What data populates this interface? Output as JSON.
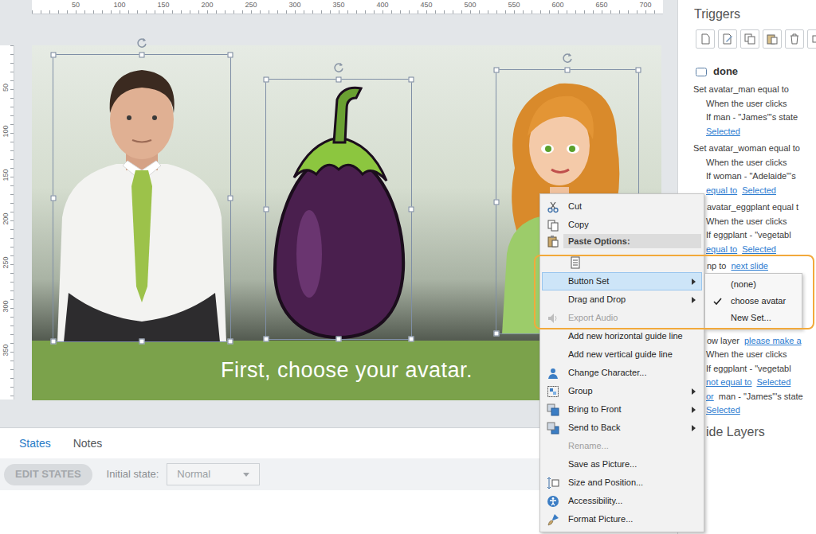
{
  "ruler": {
    "horizontal": [
      "50",
      "100",
      "150",
      "200",
      "250",
      "300",
      "350",
      "400",
      "450",
      "500",
      "550",
      "600",
      "650",
      "700"
    ],
    "vertical": [
      "50",
      "100",
      "150",
      "200",
      "250",
      "300",
      "350"
    ]
  },
  "slide": {
    "caption": "First, choose your avatar.",
    "objects": [
      {
        "kind": "man",
        "selected": true
      },
      {
        "kind": "eggplant",
        "selected": true
      },
      {
        "kind": "woman",
        "selected": true
      }
    ]
  },
  "states_panel": {
    "tabs": [
      {
        "label": "States",
        "selected": true
      },
      {
        "label": "Notes",
        "selected": false
      }
    ],
    "edit_button": {
      "label": "EDIT STATES",
      "disabled": true
    },
    "initial_state": {
      "label": "Initial state:",
      "value": "Normal",
      "disabled": true
    }
  },
  "context_menu": {
    "items": [
      {
        "kind": "item",
        "label": "Cut",
        "disabled": false,
        "submenu": false,
        "highlighted": false
      },
      {
        "kind": "item",
        "label": "Copy",
        "disabled": false,
        "submenu": false,
        "highlighted": false
      },
      {
        "kind": "header",
        "label": "Paste Options:"
      },
      {
        "kind": "paste-row"
      },
      {
        "kind": "item",
        "label": "Button Set",
        "disabled": false,
        "submenu": true,
        "highlighted": true
      },
      {
        "kind": "item",
        "label": "Drag and Drop",
        "disabled": false,
        "submenu": true,
        "highlighted": false
      },
      {
        "kind": "item",
        "label": "Export Audio",
        "disabled": true,
        "submenu": false,
        "highlighted": false
      },
      {
        "kind": "item",
        "label": "Add new horizontal guide line",
        "disabled": false,
        "submenu": false,
        "highlighted": false
      },
      {
        "kind": "item",
        "label": "Add new vertical guide line",
        "disabled": false,
        "submenu": false,
        "highlighted": false
      },
      {
        "kind": "item",
        "label": "Change Character...",
        "disabled": false,
        "submenu": false,
        "highlighted": false
      },
      {
        "kind": "item",
        "label": "Group",
        "disabled": false,
        "submenu": true,
        "highlighted": false
      },
      {
        "kind": "item",
        "label": "Bring to Front",
        "disabled": false,
        "submenu": true,
        "highlighted": false
      },
      {
        "kind": "item",
        "label": "Send to Back",
        "disabled": false,
        "submenu": true,
        "highlighted": false
      },
      {
        "kind": "item",
        "label": "Rename...",
        "disabled": true,
        "submenu": false,
        "highlighted": false
      },
      {
        "kind": "item",
        "label": "Save as Picture...",
        "disabled": false,
        "submenu": false,
        "highlighted": false
      },
      {
        "kind": "item",
        "label": "Size and Position...",
        "disabled": false,
        "submenu": false,
        "highlighted": false
      },
      {
        "kind": "item",
        "label": "Accessibility...",
        "disabled": false,
        "submenu": false,
        "highlighted": false
      },
      {
        "kind": "item",
        "label": "Format Picture...",
        "disabled": false,
        "submenu": false,
        "highlighted": false
      }
    ]
  },
  "submenu": {
    "items": [
      {
        "label": "(none)",
        "checked": false
      },
      {
        "label": "choose avatar",
        "checked": true
      },
      {
        "label": "New Set...",
        "checked": false
      }
    ]
  },
  "triggers_panel": {
    "title": "Triggers",
    "trigger_name": "done",
    "groups": [
      [
        {
          "lines": [
            {
              "kind": "action",
              "parts": [
                {
                  "text": "Set avatar_man equal to",
                  "link": false
                }
              ]
            },
            {
              "kind": "detail",
              "parts": [
                {
                  "text": "When the user clicks",
                  "link": false
                }
              ]
            },
            {
              "kind": "detail",
              "parts": [
                {
                  "text": "If man - \"James\"'s state",
                  "link": false
                }
              ]
            },
            {
              "kind": "detail",
              "parts": [
                {
                  "text": "Selected",
                  "link": true
                }
              ]
            }
          ]
        },
        {
          "lines": [
            {
              "kind": "action",
              "parts": [
                {
                  "text": "Set avatar_woman equal to",
                  "link": false
                }
              ]
            },
            {
              "kind": "detail",
              "parts": [
                {
                  "text": "When the user clicks",
                  "link": false
                }
              ]
            },
            {
              "kind": "detail",
              "parts": [
                {
                  "text": "If woman - \"Adelaide\"'s",
                  "link": false
                }
              ]
            },
            {
              "kind": "detail",
              "parts": [
                {
                  "text": "equal to",
                  "link": true
                },
                {
                  "text": "Selected",
                  "link": true
                }
              ]
            }
          ]
        },
        {
          "lines": [
            {
              "kind": "action-partial",
              "parts": [
                {
                  "text": "avatar_eggplant equal t",
                  "link": false
                }
              ]
            },
            {
              "kind": "detail",
              "parts": [
                {
                  "text": "When the user clicks",
                  "link": false
                }
              ]
            },
            {
              "kind": "detail",
              "parts": [
                {
                  "text": "If eggplant - \"vegetabl",
                  "link": false
                }
              ]
            },
            {
              "kind": "detail",
              "parts": [
                {
                  "text": "equal to",
                  "link": true
                },
                {
                  "text": "Selected",
                  "link": true
                }
              ]
            }
          ]
        },
        {
          "lines": [
            {
              "kind": "action-partial",
              "parts": [
                {
                  "text": "np to",
                  "link": false
                },
                {
                  "text": "next slide",
                  "link": true
                }
              ]
            }
          ]
        }
      ],
      [
        {
          "lines": [
            {
              "kind": "action-partial",
              "parts": [
                {
                  "text": "ow layer",
                  "link": false
                },
                {
                  "text": "please make a",
                  "link": true
                }
              ]
            },
            {
              "kind": "detail",
              "parts": [
                {
                  "text": "When the user clicks",
                  "link": false
                }
              ]
            },
            {
              "kind": "detail",
              "parts": [
                {
                  "text": "If eggplant - \"vegetabl",
                  "link": false
                }
              ]
            },
            {
              "kind": "detail",
              "parts": [
                {
                  "text": "not equal to",
                  "link": true
                },
                {
                  "text": "Selected",
                  "link": true
                }
              ]
            },
            {
              "kind": "detail",
              "parts": [
                {
                  "text": "or",
                  "link": true
                },
                {
                  "text": "man - \"James\"'s state",
                  "link": false
                }
              ]
            },
            {
              "kind": "detail",
              "parts": [
                {
                  "text": "Selected",
                  "link": true
                }
              ]
            }
          ]
        }
      ]
    ],
    "layers_heading": "ide Layers"
  }
}
